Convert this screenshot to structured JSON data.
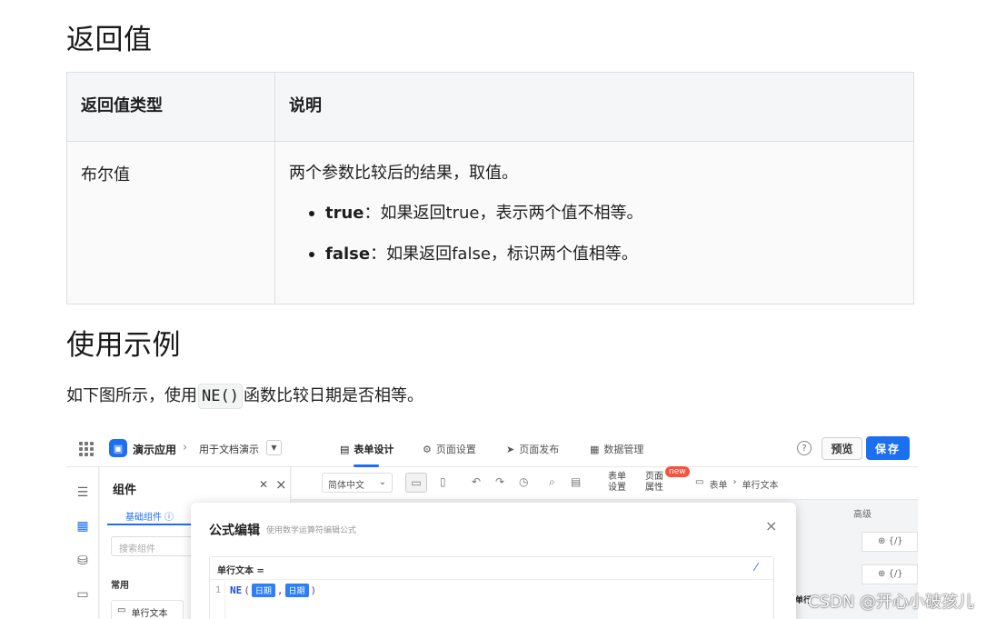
{
  "sections": {
    "return_heading": "返回值",
    "example_heading": "使用示例"
  },
  "return_table": {
    "headers": [
      "返回值类型",
      "说明"
    ],
    "type": "布尔值",
    "desc": "两个参数比较后的结果，取值。",
    "bullets": [
      {
        "term": "true",
        "text": "：如果返回true，表示两个值不相等。"
      },
      {
        "term": "false",
        "text": "：如果返回false，标识两个值相等。"
      }
    ]
  },
  "example": {
    "before": "如下图所示，使用",
    "code": "NE()",
    "after": "函数比较日期是否相等。"
  },
  "screenshot": {
    "app_name": "演示应用",
    "doc_name": "用于文档演示",
    "tabs": [
      "表单设计",
      "页面设置",
      "页面发布",
      "数据管理"
    ],
    "help": "?",
    "preview": "预览",
    "save": "保存",
    "panel": {
      "title": "组件",
      "tab": "基础组件",
      "search_placeholder": "搜索组件",
      "section": "常用",
      "item": "单行文本"
    },
    "lang": "简体中文",
    "form_settings": [
      "表单",
      "设置"
    ],
    "page_props": [
      "页面",
      "属性"
    ],
    "new_badge": "new",
    "crumb": [
      "表单",
      "单行文本"
    ],
    "advanced": "高级",
    "fx": "{/}",
    "modal": {
      "title": "公式编辑",
      "subtitle": "使用数学运算符编辑公式",
      "field_label": "单行文本 =",
      "line_no": "1",
      "fn": "NE",
      "arg1": "日期",
      "arg2": "日期",
      "side_fragment": "单行"
    }
  },
  "watermark": "CSDN @开心小破孩儿"
}
